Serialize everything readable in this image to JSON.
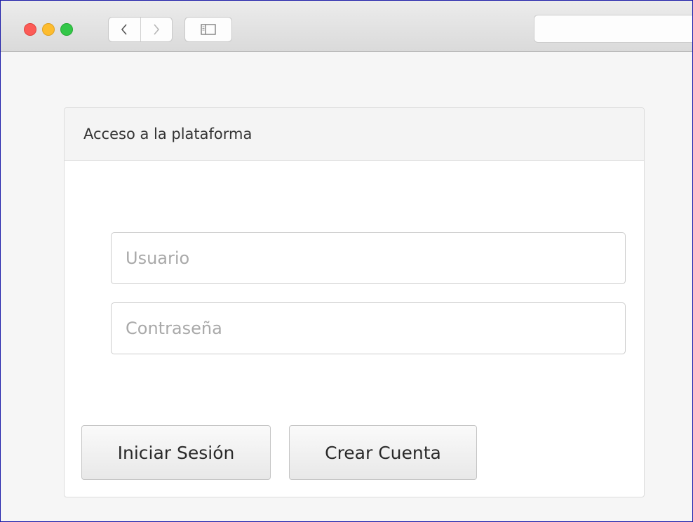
{
  "browser": {
    "back_icon": "chevron-left-icon",
    "forward_icon": "chevron-right-icon",
    "sidebar_icon": "sidebar-icon",
    "traffic_colors": {
      "close": "#fc5b57",
      "minimize": "#fdbc2e",
      "zoom": "#33c748"
    }
  },
  "panel": {
    "title": "Acceso a la plataforma"
  },
  "form": {
    "username_placeholder": "Usuario",
    "username_value": "",
    "password_placeholder": "Contraseña",
    "password_value": ""
  },
  "actions": {
    "login_label": "Iniciar Sesión",
    "create_account_label": "Crear Cuenta"
  }
}
